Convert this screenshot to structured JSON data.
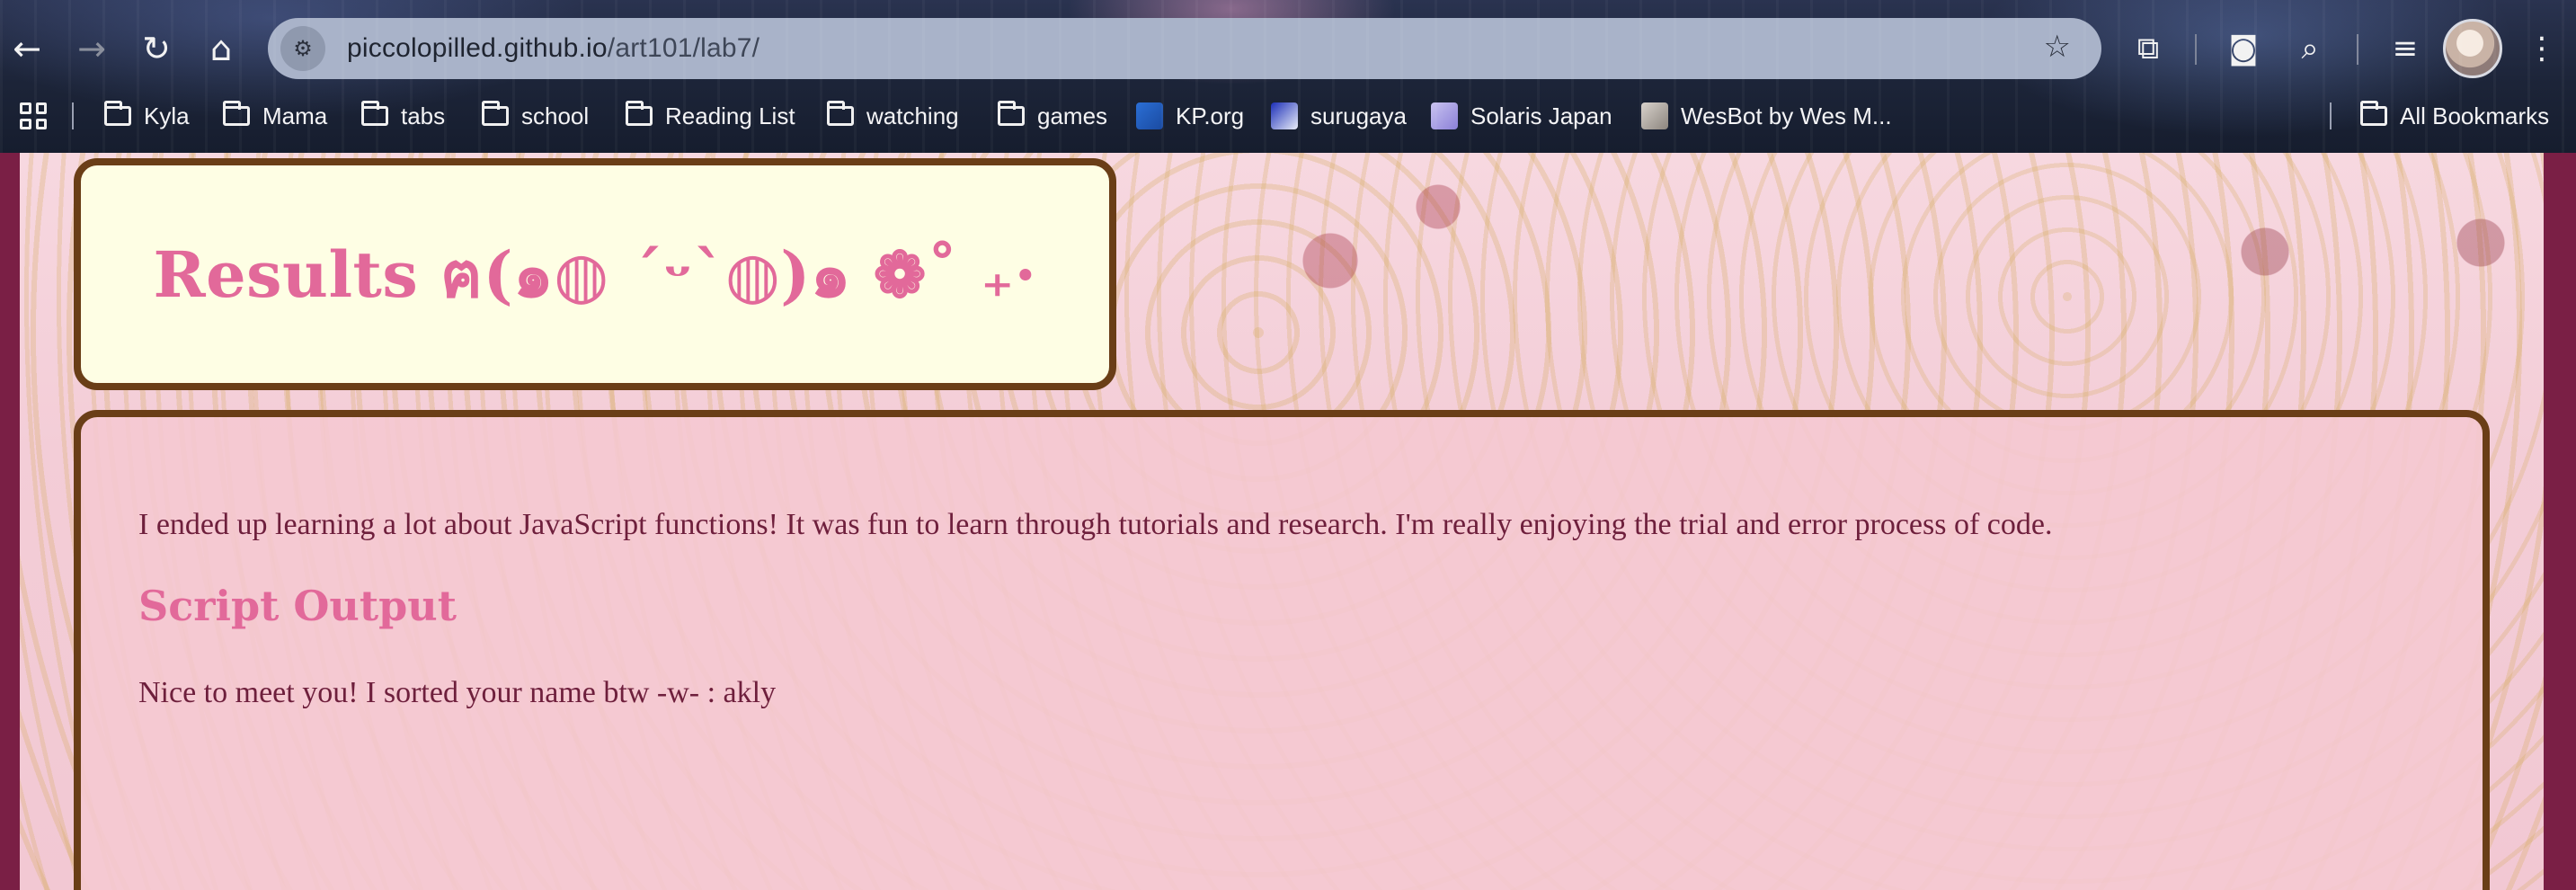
{
  "browser": {
    "url_host": "piccolopilled.github.io",
    "url_path": "/art101/lab7/",
    "bookmarks": [
      {
        "label": "Kyla",
        "type": "folder"
      },
      {
        "label": "Mama",
        "type": "folder"
      },
      {
        "label": "tabs",
        "type": "folder"
      },
      {
        "label": "school",
        "type": "folder"
      },
      {
        "label": "Reading List",
        "type": "folder"
      },
      {
        "label": "watching",
        "type": "folder"
      },
      {
        "label": "games",
        "type": "folder"
      },
      {
        "label": "KP.org",
        "type": "site"
      },
      {
        "label": "surugaya",
        "type": "site"
      },
      {
        "label": "Solaris Japan",
        "type": "site"
      },
      {
        "label": "WesBot by Wes M...",
        "type": "site"
      }
    ],
    "all_bookmarks": "All Bookmarks"
  },
  "page": {
    "title": "Results ฅ(๑◍ ˊᵕˋ◍)๑ ❁˚ ₊·",
    "intro": "I ended up learning a lot about JavaScript functions! It was fun to learn through tutorials and research. I'm really enjoying the trial and error process of code.",
    "output_heading": "Script Output",
    "output_text": "Nice to meet you! I sorted your name btw -w- : akly"
  },
  "colors": {
    "title_pink": "#e2699a",
    "text_maroon": "#6e1f3c",
    "box_border": "#6a3e17",
    "title_bg": "#fefee4"
  }
}
